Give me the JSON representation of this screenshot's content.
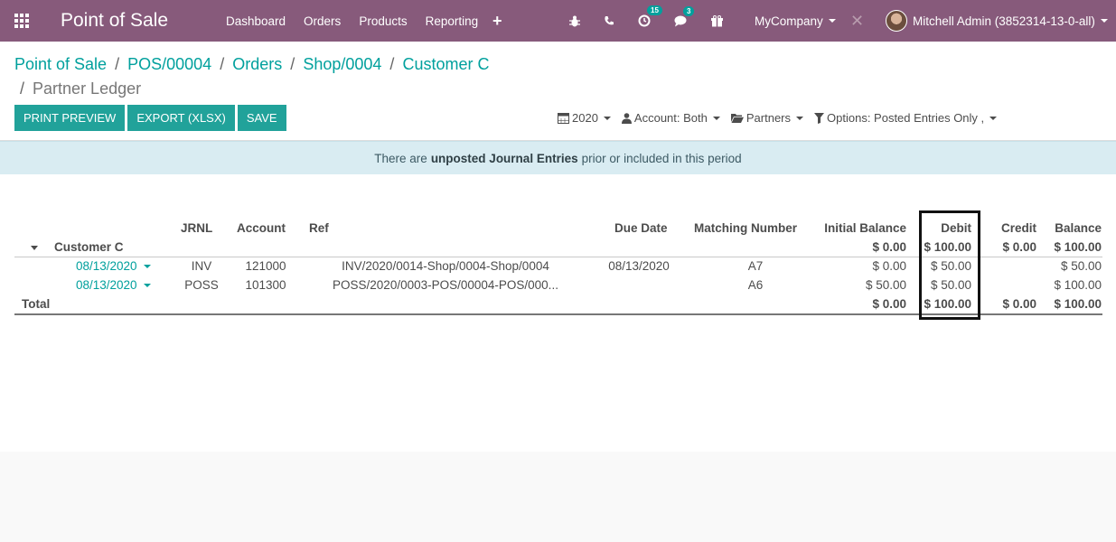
{
  "navbar": {
    "app_title": "Point of Sale",
    "menu": [
      "Dashboard",
      "Orders",
      "Products",
      "Reporting"
    ],
    "plus": "+",
    "activity_badge": "15",
    "messages_badge": "3",
    "company": "MyCompany",
    "user": "Mitchell Admin (3852314-13-0-all)"
  },
  "breadcrumb": {
    "items": [
      "Point of Sale",
      "POS/00004",
      "Orders",
      "Shop/0004",
      "Customer C"
    ],
    "sep": "/",
    "active": "Partner Ledger"
  },
  "buttons": {
    "print": "PRINT PREVIEW",
    "export": "EXPORT (XLSX)",
    "save": "SAVE"
  },
  "filters": {
    "date": "2020",
    "account": "Account: Both",
    "partners": "Partners",
    "options": "Options: Posted Entries Only ,"
  },
  "alert": {
    "prefix": "There are",
    "bold": "unposted Journal Entries",
    "suffix": "prior or included in this period"
  },
  "table": {
    "headers": {
      "jrnl": "JRNL",
      "account": "Account",
      "ref": "Ref",
      "due_date": "Due Date",
      "matching": "Matching Number",
      "initial_balance": "Initial Balance",
      "debit": "Debit",
      "credit": "Credit",
      "balance": "Balance"
    },
    "partner": {
      "name": "Customer C",
      "initial_balance": "$ 0.00",
      "debit": "$ 100.00",
      "credit": "$ 0.00",
      "balance": "$ 100.00"
    },
    "lines": [
      {
        "date": "08/13/2020",
        "jrnl": "INV",
        "account": "121000",
        "ref": "INV/2020/0014-Shop/0004-Shop/0004",
        "due_date": "08/13/2020",
        "matching": "A7",
        "initial_balance": "$ 0.00",
        "debit": "$ 50.00",
        "credit": "",
        "balance": "$ 50.00"
      },
      {
        "date": "08/13/2020",
        "jrnl": "POSS",
        "account": "101300",
        "ref": "POSS/2020/0003-POS/00004-POS/000...",
        "due_date": "",
        "matching": "A6",
        "initial_balance": "$ 50.00",
        "debit": "$ 50.00",
        "credit": "",
        "balance": "$ 100.00"
      }
    ],
    "total": {
      "label": "Total",
      "initial_balance": "$ 0.00",
      "debit": "$ 100.00",
      "credit": "$ 0.00",
      "balance": "$ 100.00"
    }
  }
}
